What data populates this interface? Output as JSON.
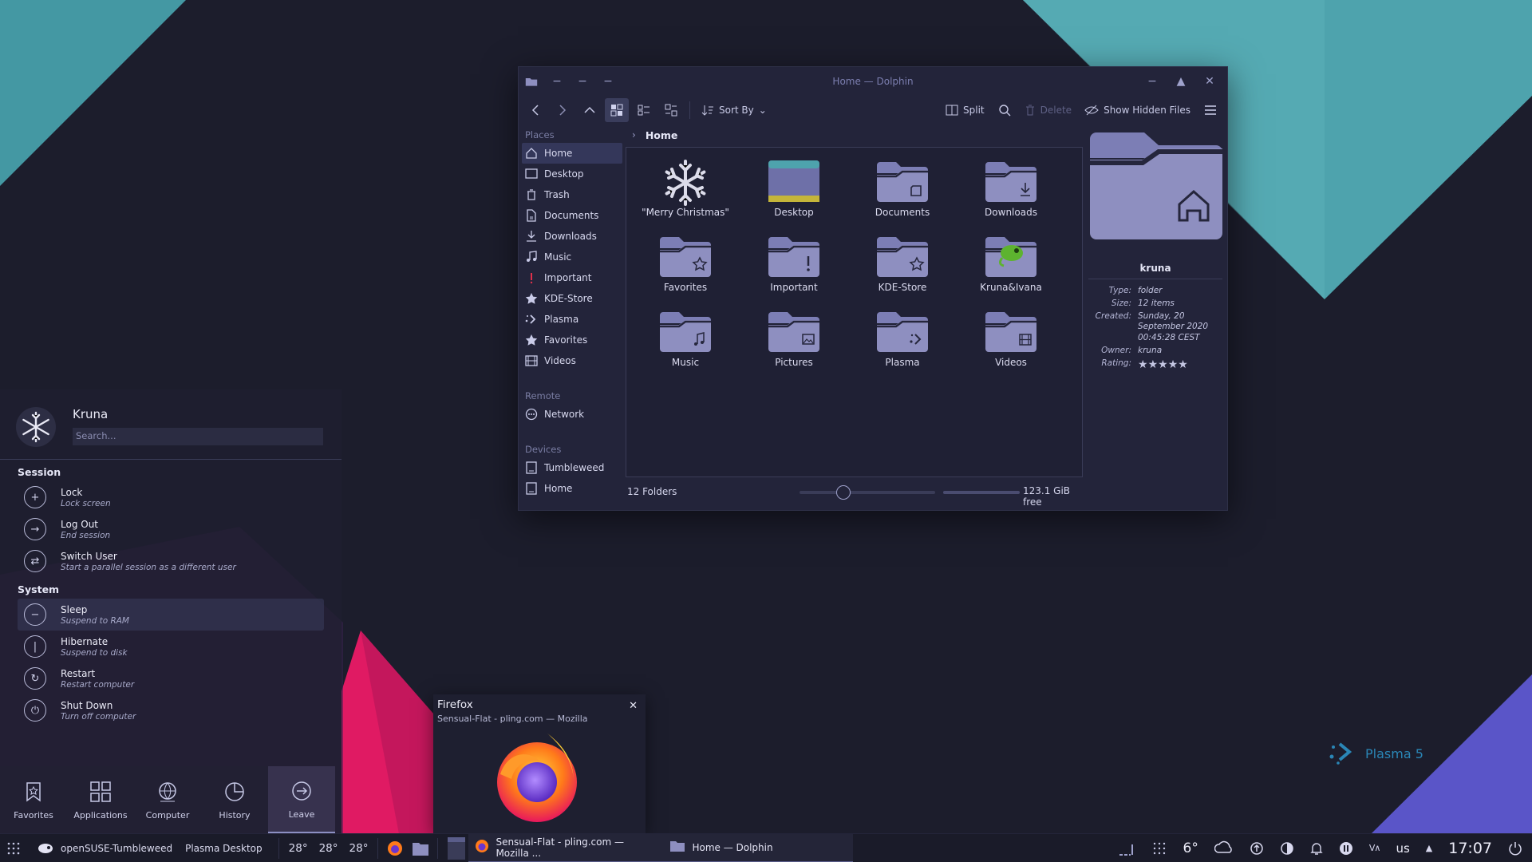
{
  "window": {
    "title": "Home — Dolphin",
    "toolbar": {
      "sort_label": "Sort By",
      "split_label": "Split",
      "delete_label": "Delete",
      "hidden_label": "Show Hidden Files"
    },
    "places_header": "Places",
    "places": [
      {
        "label": "Home",
        "icon": "home-icon"
      },
      {
        "label": "Desktop",
        "icon": "desktop-icon"
      },
      {
        "label": "Trash",
        "icon": "trash-icon"
      },
      {
        "label": "Documents",
        "icon": "documents-icon"
      },
      {
        "label": "Downloads",
        "icon": "downloads-icon"
      },
      {
        "label": "Music",
        "icon": "music-icon"
      },
      {
        "label": "Important",
        "icon": "exclamation-icon"
      },
      {
        "label": "KDE-Store",
        "icon": "star-icon"
      },
      {
        "label": "Plasma",
        "icon": "plasma-icon"
      },
      {
        "label": "Favorites",
        "icon": "star-icon"
      },
      {
        "label": "Videos",
        "icon": "video-icon"
      }
    ],
    "remote_header": "Remote",
    "remote": [
      {
        "label": "Network",
        "icon": "network-icon"
      }
    ],
    "devices_header": "Devices",
    "devices": [
      {
        "label": "Tumbleweed",
        "icon": "drive-icon"
      },
      {
        "label": "Home",
        "icon": "drive-icon"
      }
    ],
    "breadcrumb": "Home",
    "files": [
      {
        "name": "\"Merry Christmas\"",
        "icon": "snowflake-icon"
      },
      {
        "name": "Desktop",
        "icon": "desktop-folder-icon"
      },
      {
        "name": "Documents",
        "icon": "folder-documents-icon"
      },
      {
        "name": "Downloads",
        "icon": "folder-downloads-icon"
      },
      {
        "name": "Favorites",
        "icon": "folder-favorites-icon"
      },
      {
        "name": "Important",
        "icon": "folder-important-icon"
      },
      {
        "name": "KDE-Store",
        "icon": "folder-kde-store-icon"
      },
      {
        "name": "Kruna&Ivana",
        "icon": "folder-chameleon-icon"
      },
      {
        "name": "Music",
        "icon": "folder-music-icon"
      },
      {
        "name": "Pictures",
        "icon": "folder-pictures-icon"
      },
      {
        "name": "Plasma",
        "icon": "folder-plasma-icon"
      },
      {
        "name": "Videos",
        "icon": "folder-videos-icon"
      }
    ],
    "status": {
      "count": "12 Folders",
      "free": "123.1 GiB free"
    },
    "info": {
      "name": "kruna",
      "type_k": "Type:",
      "type_v": "folder",
      "size_k": "Size:",
      "size_v": "12 items",
      "created_k": "Created:",
      "created_v": "Sunday, 20 September 2020 00:45:28 CEST",
      "owner_k": "Owner:",
      "owner_v": "kruna",
      "rating_k": "Rating:",
      "rating_stars": 5
    }
  },
  "launcher": {
    "user": "Kruna",
    "search_placeholder": "Search...",
    "session_header": "Session",
    "session": [
      {
        "title": "Lock",
        "sub": "Lock screen",
        "icon": "lock-icon"
      },
      {
        "title": "Log Out",
        "sub": "End session",
        "icon": "logout-icon"
      },
      {
        "title": "Switch User",
        "sub": "Start a parallel session as a different user",
        "icon": "switch-user-icon"
      }
    ],
    "system_header": "System",
    "system": [
      {
        "title": "Sleep",
        "sub": "Suspend to RAM",
        "icon": "sleep-icon"
      },
      {
        "title": "Hibernate",
        "sub": "Suspend to disk",
        "icon": "hibernate-icon"
      },
      {
        "title": "Restart",
        "sub": "Restart computer",
        "icon": "restart-icon"
      },
      {
        "title": "Shut Down",
        "sub": "Turn off computer",
        "icon": "shutdown-icon"
      }
    ],
    "tabs": [
      {
        "label": "Favorites",
        "icon": "bookmark-icon"
      },
      {
        "label": "Applications",
        "icon": "apps-grid-icon"
      },
      {
        "label": "Computer",
        "icon": "computer-icon"
      },
      {
        "label": "History",
        "icon": "history-icon"
      },
      {
        "label": "Leave",
        "icon": "leave-icon"
      }
    ]
  },
  "firefox_preview": {
    "title": "Firefox",
    "subtitle": "Sensual-Flat - pling.com — Mozilla"
  },
  "plasma_watermark": "Plasma 5",
  "panel": {
    "distro": "openSUSE-Tumbleweed",
    "desktop": "Plasma Desktop",
    "temps": [
      "28°",
      "28°",
      "28°"
    ],
    "tasks": [
      {
        "label": "Sensual-Flat - pling.com — Mozilla ...",
        "icon": "firefox-icon"
      },
      {
        "label": "Home — Dolphin",
        "icon": "dolphin-icon"
      }
    ],
    "weather": "6°",
    "kbd": "us",
    "clock": "17:07"
  },
  "colors": {
    "background": "#1c1d2c",
    "teal": "#4ea3ad",
    "magenta": "#e01a63",
    "violet": "#5a55c8",
    "folder": "#8e8fc0"
  }
}
